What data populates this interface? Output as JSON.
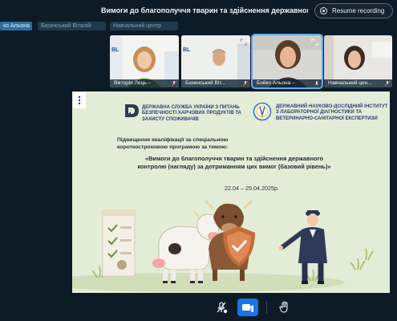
{
  "header": {
    "meeting_title": "Вимоги до благополуччя тварин та здійснення державного контролю (н...",
    "resume_recording_label": "Resume recording"
  },
  "name_chips": [
    {
      "label": "ко Альона",
      "active": true
    },
    {
      "label": "Базинський Віталій",
      "active": false
    },
    {
      "label": "Навчальний центр",
      "active": false
    }
  ],
  "participants": [
    {
      "name": "Вікторія Лець –"
    },
    {
      "name": "Базинський Віт..."
    },
    {
      "name": "Бойко Альона –"
    },
    {
      "name": "Навчальний цен..."
    }
  ],
  "slide": {
    "org_left": "ДЕРЖАВНА СЛУЖБА УКРАЇНИ З ПИТАНЬ БЕЗПЕЧНОСТІ ХАРЧОВИХ ПРОДУКТІВ ТА ЗАХИСТУ СПОЖИВАЧІВ",
    "org_right": "ДЕРЖАВНИЙ НАУКОВО-ДОСЛІДНИЙ ІНСТИТУТ З ЛАБОРАТОРНОЇ ДІАГНОСТИКИ ТА ВЕТЕРИНАРНО-САНІТАРНОЇ ЕКСПЕРТИЗИ",
    "intro": "Підвищення кваліфікації за спеціальною короткостроковою програмою за темою:",
    "course_title": "«Вимоги до благополуччя тварин та здійснення державного контролю (нагляду) за дотриманням цих вимог (базовий рівень)»",
    "dates": "22.04 – 25.04.2025р."
  },
  "colors": {
    "background": "#0d1b26",
    "accent": "#2d6fa3",
    "slide_bg": "#e3ecd6",
    "org_text": "#2f3d7a",
    "video_on": "#1a73e8"
  },
  "icons": {
    "rec": "record-icon",
    "mic": "mic-muted-icon",
    "camera": "camera-icon",
    "hand": "raise-hand-icon",
    "expand": "expand-icon",
    "menu": "more-options-icon"
  }
}
